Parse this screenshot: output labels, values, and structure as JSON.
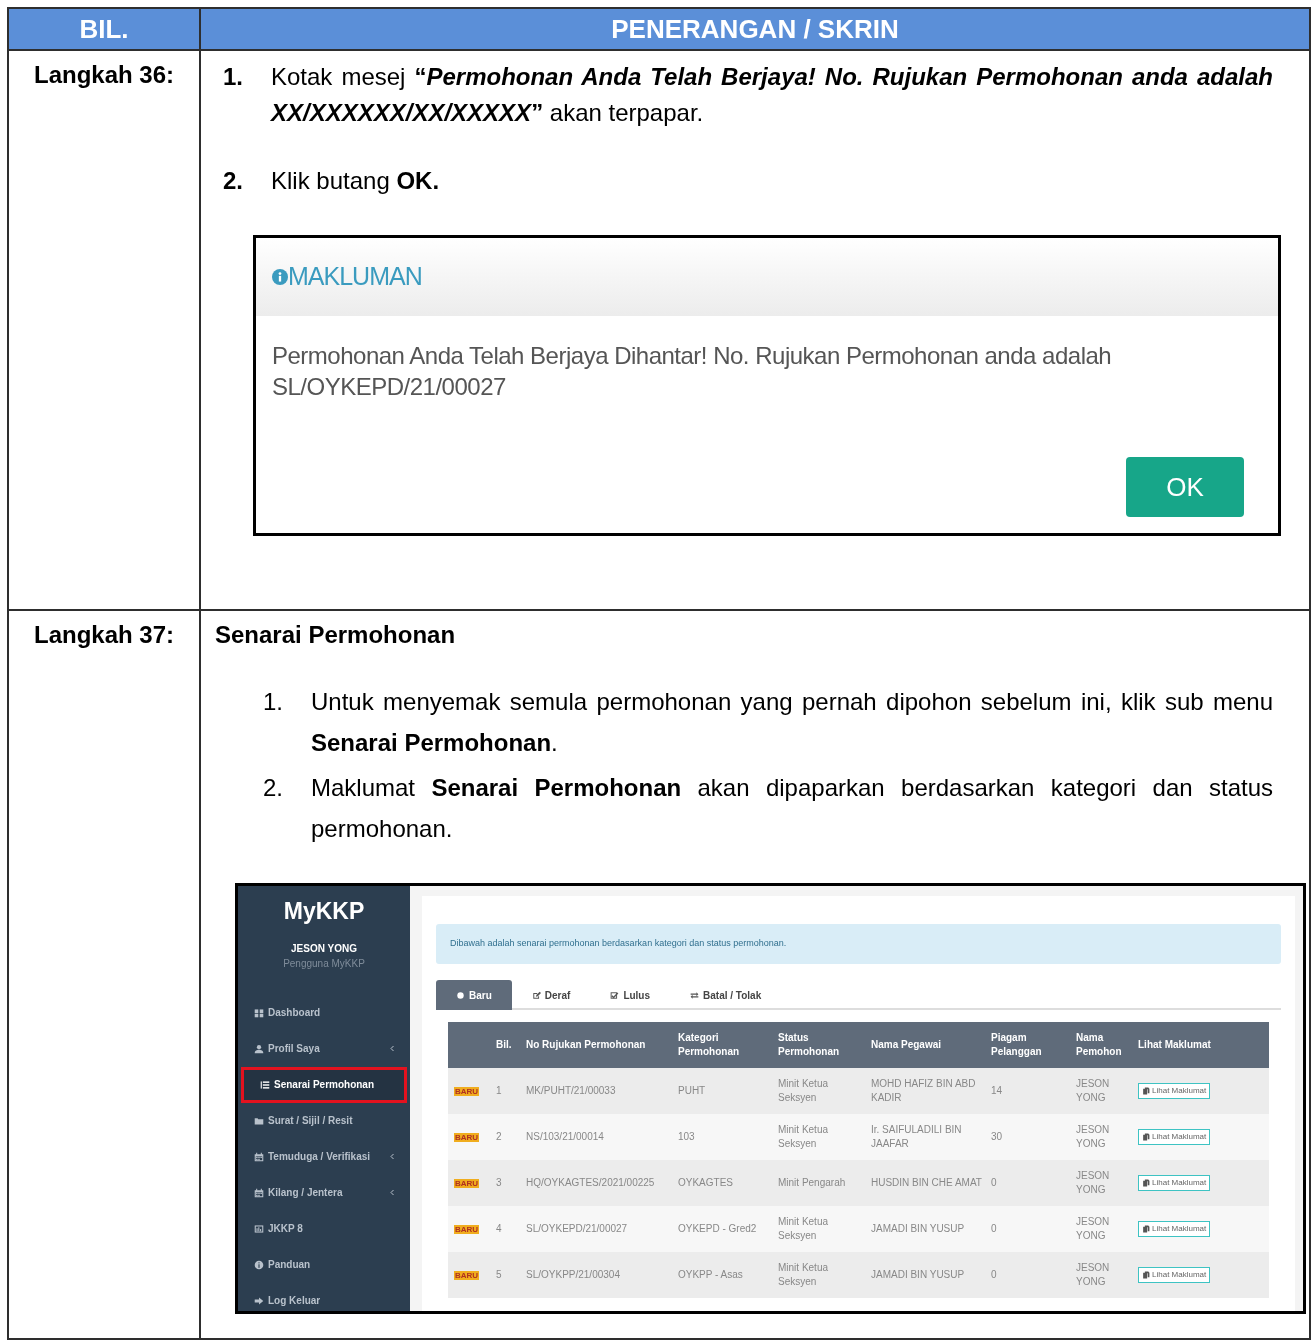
{
  "table_headers": [
    "BIL.",
    "PENERANGAN / SKRIN"
  ],
  "steps": [
    {
      "label": "Langkah 36:",
      "kind": "dialog_step",
      "items": [
        {
          "number": "1.",
          "text": "Kotak mesej **“*Permohonan Anda Telah Berjaya! No. Rujukan Permohonan anda adalah XX/XXXXXX/XX/XXXXX*”** akan terpapar."
        },
        {
          "number": "2.",
          "text": "Klik butang **OK.**"
        }
      ],
      "dialog": {
        "title": "MAKLUMAN",
        "message": "Permohonan Anda Telah Berjaya Dihantar! No. Rujukan Permohonan anda adalah SL/OYKEPD/21/00027",
        "button": "OK"
      }
    },
    {
      "label": "Langkah 37:",
      "kind": "list_step",
      "heading": "Senarai Permohonan",
      "items": [
        {
          "number": "1.",
          "text": "Untuk menyemak semula permohonan yang pernah dipohon sebelum ini, klik sub menu **Senarai Permohonan**."
        },
        {
          "number": "2.",
          "text": "Maklumat **Senarai Permohonan** akan dipaparkan berdasarkan kategori dan status permohonan."
        }
      ],
      "app": {
        "brand": "MyKKP",
        "user_name": "JESON YONG",
        "user_role": "Pengguna MyKKP",
        "sidebar": [
          {
            "label": "Dashboard",
            "submenu": false,
            "selected": false
          },
          {
            "label": "Profil Saya",
            "submenu": true,
            "selected": false
          },
          {
            "label": "Senarai Permohonan",
            "submenu": false,
            "selected": true
          },
          {
            "label": "Surat / Sijil / Resit",
            "submenu": false,
            "selected": false
          },
          {
            "label": "Temuduga / Verifikasi",
            "submenu": true,
            "selected": false
          },
          {
            "label": "Kilang / Jentera",
            "submenu": true,
            "selected": false
          },
          {
            "label": "JKKP 8",
            "submenu": false,
            "selected": false
          },
          {
            "label": "Panduan",
            "submenu": false,
            "selected": false
          },
          {
            "label": "Log Keluar",
            "submenu": false,
            "selected": false
          }
        ],
        "notice": "Dibawah adalah senarai permohonan berdasarkan kategori dan status permohonan.",
        "tabs": [
          {
            "label": "Baru",
            "selected": true
          },
          {
            "label": "Deraf",
            "selected": false
          },
          {
            "label": "Lulus",
            "selected": false
          },
          {
            "label": "Batal / Tolak",
            "selected": false
          }
        ],
        "columns": [
          "",
          "Bil.",
          "No Rujukan Permohonan",
          "Kategori Permohonan",
          "Status Permohonan",
          "Nama Pegawai",
          "Piagam Pelanggan",
          "Nama Pemohon",
          "Lihat Maklumat"
        ],
        "rows": [
          [
            "BARU",
            "1",
            "MK/PUHT/21/00033",
            "PUHT",
            "Minit Ketua Seksyen",
            "MOHD HAFIZ BIN ABD KADIR",
            "14",
            "JESON YONG",
            "Lihat Maklumat"
          ],
          [
            "BARU",
            "2",
            "NS/103/21/00014",
            "103",
            "Minit Ketua Seksyen",
            "Ir. SAIFULADILI BIN JAAFAR",
            "30",
            "JESON YONG",
            "Lihat Maklumat"
          ],
          [
            "BARU",
            "3",
            "HQ/OYKAGTES/2021/00225",
            "OYKAGTES",
            "Minit Pengarah",
            "HUSDIN BIN CHE AMAT",
            "0",
            "JESON YONG",
            "Lihat Maklumat"
          ],
          [
            "BARU",
            "4",
            "SL/OYKEPD/21/00027",
            "OYKEPD - Gred2",
            "Minit Ketua Seksyen",
            "JAMADI BIN YUSUP",
            "0",
            "JESON YONG",
            "Lihat Maklumat"
          ],
          [
            "BARU",
            "5",
            "SL/OYKPP/21/00304",
            "OYKPP - Asas",
            "Minit Ketua Seksyen",
            "JAMADI BIN YUSUP",
            "0",
            "JESON YONG",
            "Lihat Maklumat"
          ]
        ]
      }
    }
  ]
}
